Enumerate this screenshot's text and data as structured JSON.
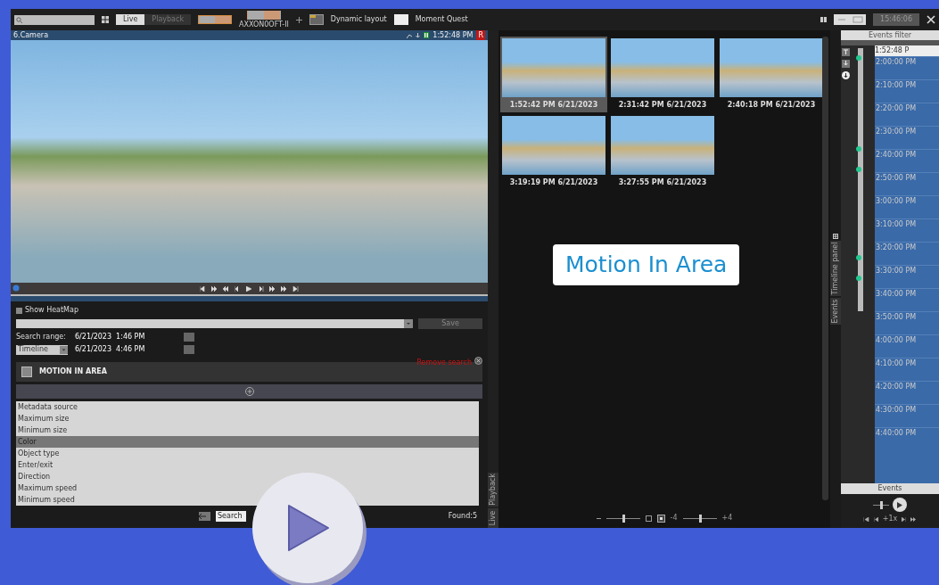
{
  "toolbar": {
    "mode_tabs": [
      {
        "label": "Live",
        "selected": true
      },
      {
        "label": "Playback",
        "selected": false
      }
    ],
    "layouts": [
      {
        "selected": true
      },
      {
        "selected": false,
        "label": "AXXON0OFT-II"
      }
    ],
    "dynamic_layout": "Dynamic layout",
    "moment_quest": "Moment Quest",
    "clock": "15:46:06"
  },
  "camera": {
    "title": "6.Camera",
    "time": "1:52:48 PM",
    "recording_badge": "R"
  },
  "heatmap": {
    "label": "Show HeatMap",
    "checked": false
  },
  "save_button": "Save",
  "search_range": {
    "label": "Search range:",
    "mode": "Timeline",
    "from": "6/21/2023  1:46 PM",
    "to": "6/21/2023  4:46 PM"
  },
  "criterion": {
    "title": "MOTION IN AREA",
    "remove_label": "Remove search"
  },
  "options": [
    {
      "label": "Metadata source",
      "selected": false
    },
    {
      "label": "Maximum size",
      "selected": false
    },
    {
      "label": "Minimum size",
      "selected": false
    },
    {
      "label": "Color",
      "selected": true
    },
    {
      "label": "Object type",
      "selected": false
    },
    {
      "label": "Enter/exit",
      "selected": false
    },
    {
      "label": "Direction",
      "selected": false
    },
    {
      "label": "Maximum speed",
      "selected": false
    },
    {
      "label": "Minimum speed",
      "selected": false
    }
  ],
  "search_button": "Search",
  "found": "Found:5",
  "results": [
    {
      "time": "1:52:42 PM 6/21/2023",
      "selected": true
    },
    {
      "time": "2:31:42 PM 6/21/2023",
      "selected": false
    },
    {
      "time": "2:40:18 PM 6/21/2023",
      "selected": false
    },
    {
      "time": "3:19:19 PM 6/21/2023",
      "selected": false
    },
    {
      "time": "3:27:55 PM 6/21/2023",
      "selected": false
    }
  ],
  "zoom_sliders": [
    {
      "level": 0.5
    },
    {
      "min_label": "-4",
      "max_label": "+4",
      "level": 0.5
    }
  ],
  "side_tabs": [
    "Live",
    "Playback"
  ],
  "panel_tabs": [
    "Timeline panel",
    "Events"
  ],
  "events_panel": {
    "title": "Events filter",
    "current_time": "1:52:48 P",
    "times": [
      "2:00:00 PM",
      "2:10:00 PM",
      "2:20:00 PM",
      "2:30:00 PM",
      "2:40:00 PM",
      "2:50:00 PM",
      "3:00:00 PM",
      "3:10:00 PM",
      "3:20:00 PM",
      "3:30:00 PM",
      "3:40:00 PM",
      "3:50:00 PM",
      "4:00:00 PM",
      "4:10:00 PM",
      "4:20:00 PM",
      "4:30:00 PM",
      "4:40:00 PM"
    ],
    "tab": "Events",
    "speed": "+1x",
    "volume": {
      "level": 0.5
    }
  },
  "caption": "Motion In Area"
}
